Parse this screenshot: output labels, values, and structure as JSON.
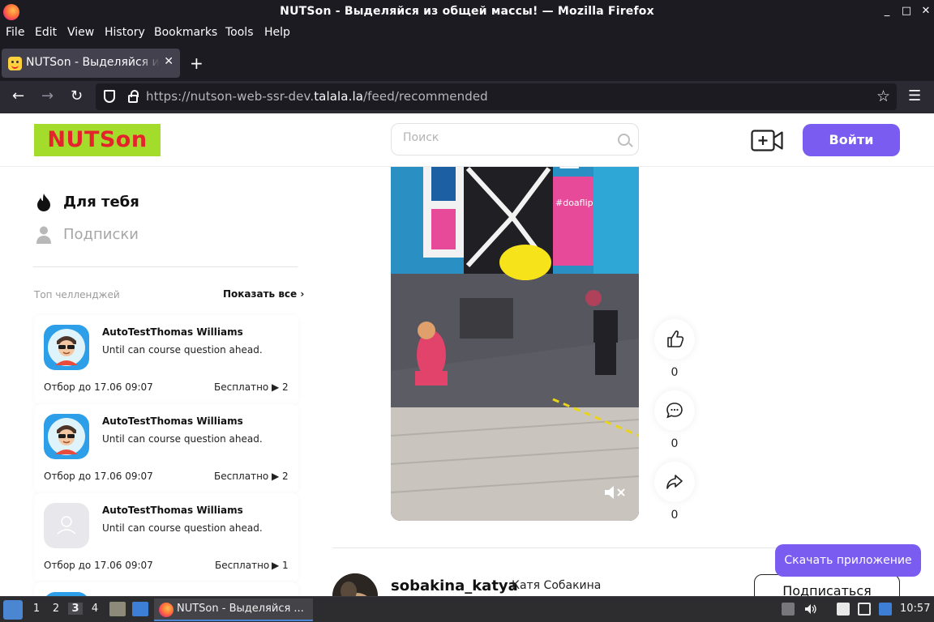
{
  "window": {
    "title": "NUTSon - Выделяйся из общей массы! — Mozilla Firefox",
    "controls": [
      "_",
      "□",
      "✕"
    ]
  },
  "menu": [
    "File",
    "Edit",
    "View",
    "History",
    "Bookmarks",
    "Tools",
    "Help"
  ],
  "tab": {
    "title": "NUTSon - Выделяйся из общей массы!",
    "close": "✕",
    "new_tab": "+"
  },
  "navbar": {
    "back": "←",
    "forward": "→",
    "reload": "↻",
    "url_prefix": "https://nutson-web-ssr-dev.",
    "url_domain": "talala.la",
    "url_path": "/feed/recommended",
    "bookmark_star": "☆",
    "menu": "☰"
  },
  "header": {
    "logo": "NUTSon",
    "search_placeholder": "Поиск",
    "login": "Войти"
  },
  "sidebar": {
    "for_you": "Для тебя",
    "subscriptions": "Подписки",
    "top_challenges": "Топ челленджей",
    "show_all": "Показать все ›",
    "challenges": [
      {
        "name": "AutoTestThomas Williams",
        "desc": "Until can course question ahead.",
        "deadline": "Отбор до 17.06 09:07",
        "price": "Бесплатно",
        "count": "▶ 2"
      },
      {
        "name": "AutoTestThomas Williams",
        "desc": "Until can course question ahead.",
        "deadline": "Отбор до 17.06 09:07",
        "price": "Бесплатно",
        "count": "▶ 2"
      },
      {
        "name": "AutoTestThomas Williams",
        "desc": "Until can course question ahead.",
        "deadline": "Отбор до 17.06 09:07",
        "price": "Бесплатно",
        "count": "▶ 1"
      }
    ]
  },
  "video": {
    "overlay_text": "#doaflip",
    "likes": "0",
    "comments": "0",
    "shares": "0"
  },
  "post": {
    "username": "sobakina_katya",
    "fullname": "Катя Собакина",
    "subscribe": "Подписаться"
  },
  "download_app": "Скачать приложение",
  "taskbar": {
    "workspaces": [
      "1",
      "2",
      "3",
      "4"
    ],
    "active_workspace": "3",
    "task_label": "NUTSon - Выделяйся ...",
    "clock": "10:57"
  },
  "colors": {
    "accent": "#7b5cf0",
    "logo_bg": "#a4dc2b",
    "logo_text": "#e4232d"
  }
}
